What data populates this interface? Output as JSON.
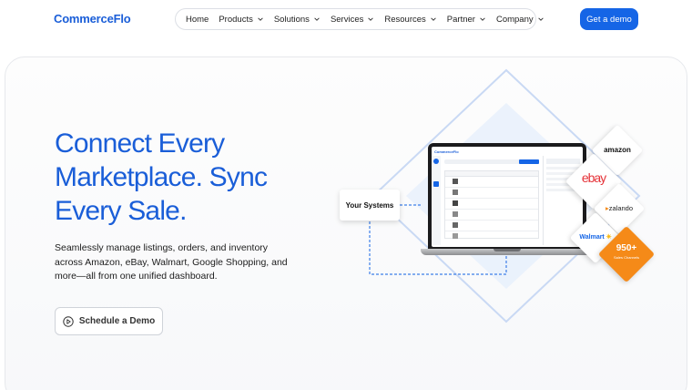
{
  "header": {
    "logo": "CommerceFlo",
    "nav": [
      {
        "label": "Home",
        "has_menu": false
      },
      {
        "label": "Products",
        "has_menu": true
      },
      {
        "label": "Solutions",
        "has_menu": true
      },
      {
        "label": "Services",
        "has_menu": true
      },
      {
        "label": "Resources",
        "has_menu": true
      },
      {
        "label": "Partner",
        "has_menu": true
      },
      {
        "label": "Company",
        "has_menu": true
      }
    ],
    "cta": "Get a demo"
  },
  "hero": {
    "headline": [
      "Connect Every",
      "Marketplace. Sync",
      "Every Sale."
    ],
    "subtext": "Seamlessly manage listings, orders, and inventory across Amazon, eBay, Walmart, Google Shopping, and more—all from one unified dashboard.",
    "button": "Schedule a Demo",
    "button_icon": "play-circle-icon"
  },
  "illustration": {
    "systems_label": "Your Systems",
    "marketplaces": [
      "amazon",
      "ebay",
      "zalando",
      "Walmart"
    ],
    "channels_count": "950+",
    "channels_label": "Sales Channels",
    "dashboard_brand": "CommerceFlo"
  },
  "colors": {
    "brand_blue": "#1a5ed8",
    "cta_blue": "#1565e6",
    "orange": "#f58a18",
    "dashed": "#3d7fe8"
  }
}
